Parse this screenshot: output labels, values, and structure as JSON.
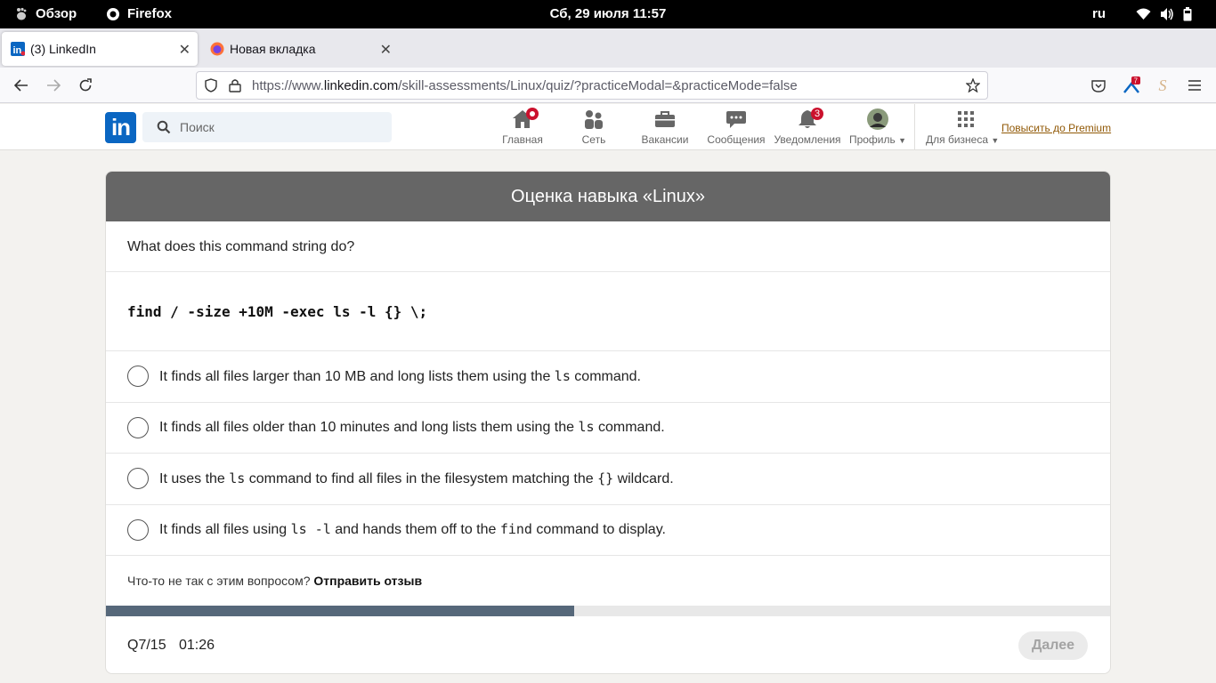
{
  "topbar": {
    "overview_label": "Обзор",
    "app_label": "Firefox",
    "clock": "Сб, 29 июля  11:57",
    "lang": "ru"
  },
  "browser": {
    "tabs": [
      {
        "label": "(3) LinkedIn",
        "active": true
      },
      {
        "label": "Новая вкладка",
        "active": false
      }
    ],
    "url_prefix": "https://www.",
    "url_domain": "linkedin.com",
    "url_path": "/skill-assessments/Linux/quiz/?practiceModal=&practiceMode=false",
    "extension_badge": "7"
  },
  "linkedin": {
    "logo": "in",
    "search_placeholder": "Поиск",
    "nav": [
      {
        "label": "Главная",
        "icon": "home-icon",
        "badge": "dot"
      },
      {
        "label": "Сеть",
        "icon": "network-icon",
        "badge": ""
      },
      {
        "label": "Вакансии",
        "icon": "jobs-icon",
        "badge": ""
      },
      {
        "label": "Сообщения",
        "icon": "messaging-icon",
        "badge": ""
      },
      {
        "label": "Уведомления",
        "icon": "bell-icon",
        "badge": "3"
      },
      {
        "label": "Профиль",
        "icon": "avatar",
        "badge": ""
      },
      {
        "label": "Для бизнеса",
        "icon": "grid-icon",
        "badge": ""
      }
    ],
    "premium_link": "Повысить до Premium"
  },
  "quiz": {
    "title": "Оценка навыка «Linux»",
    "question": "What does this command string do?",
    "code": "find / -size +10M -exec ls -l {} \\;",
    "options": [
      {
        "parts": [
          "It finds all files larger than 10 MB and long lists them using the ",
          "ls",
          " command."
        ]
      },
      {
        "parts": [
          "It finds all files older than 10 minutes and long lists them using the ",
          "ls",
          " command."
        ]
      },
      {
        "parts": [
          "It uses the ",
          "ls",
          " command to find all files in the filesystem matching the ",
          "{}",
          " wildcard."
        ]
      },
      {
        "parts": [
          "It finds all files using ",
          "ls -l",
          " and hands them off to the ",
          "find",
          " command to display."
        ]
      }
    ],
    "feedback_text": "Что-то не так с этим вопросом?",
    "feedback_link": "Отправить отзыв",
    "progress_fraction": 0.4667,
    "counter": "Q7/15",
    "timer": "01:26",
    "next_label": "Далее"
  },
  "colors": {
    "linkedin_blue": "#0a66c2",
    "header_gray": "#666666",
    "progress_fill": "#56687a",
    "badge_red": "#cb112d"
  }
}
